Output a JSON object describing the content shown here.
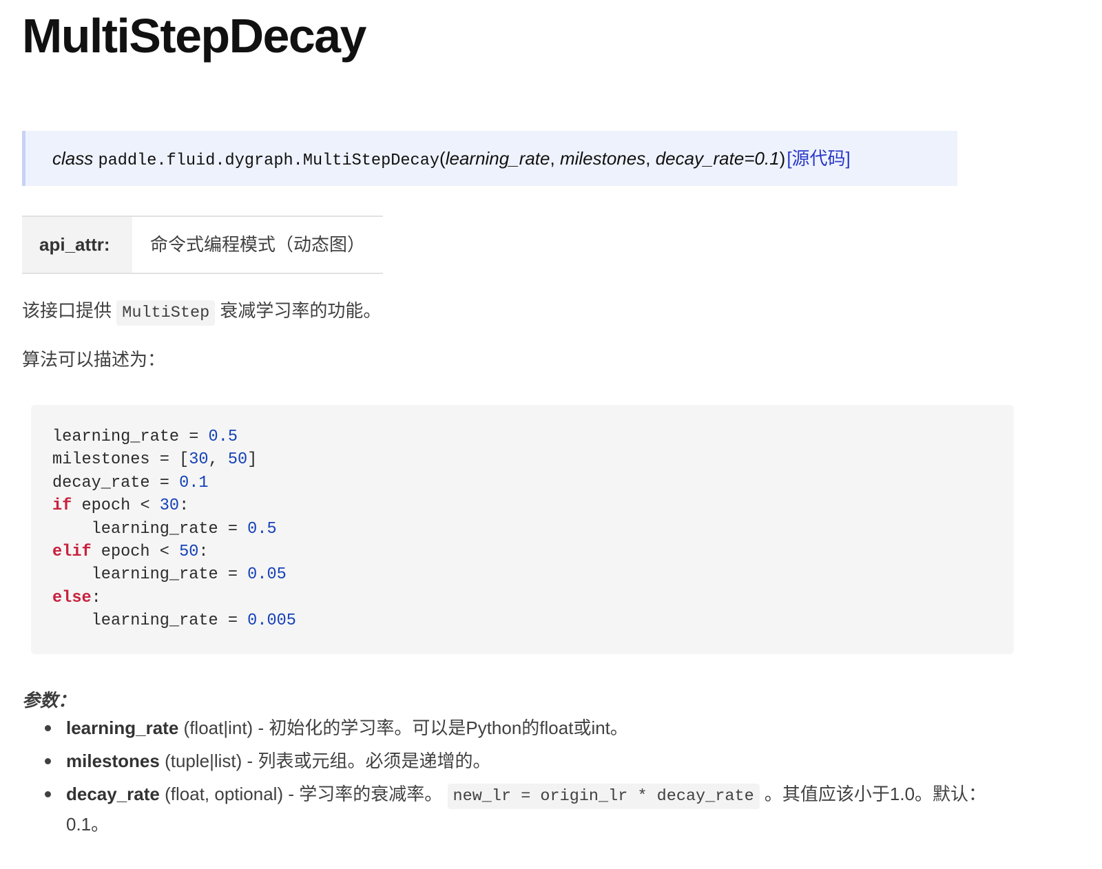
{
  "theme": {
    "text": "#404040",
    "heading": "#111111",
    "link": "#2a38c8",
    "keyword": "#c8213e",
    "number": "#1541b8",
    "code_bg": "#f5f5f5",
    "signature_bg": "#eef2fd",
    "signature_border": "#c7d2f4"
  },
  "title": "MultiStepDecay",
  "signature": {
    "prefix": "class",
    "name": "paddle.fluid.dygraph.MultiStepDecay",
    "open": "(",
    "params": [
      "learning_rate",
      "milestones",
      "decay_rate=0.1"
    ],
    "separator": ", ",
    "close": ")",
    "source_link": "[源代码]"
  },
  "api_attr": {
    "label": "api_attr:",
    "value": "命令式编程模式（动态图）"
  },
  "intro": {
    "before": "该接口提供",
    "code": "MultiStep",
    "after": "衰减学习率的功能。"
  },
  "algorithm_label": "算法可以描述为：",
  "code_block": {
    "lines": [
      [
        {
          "plain": "learning_rate = "
        },
        {
          "num": "0.5"
        }
      ],
      [
        {
          "plain": "milestones = ["
        },
        {
          "num": "30"
        },
        {
          "plain": ", "
        },
        {
          "num": "50"
        },
        {
          "plain": "]"
        }
      ],
      [
        {
          "plain": "decay_rate = "
        },
        {
          "num": "0.1"
        }
      ],
      [
        {
          "kw": "if"
        },
        {
          "plain": " epoch < "
        },
        {
          "num": "30"
        },
        {
          "plain": ":"
        }
      ],
      [
        {
          "plain": "    learning_rate = "
        },
        {
          "num": "0.5"
        }
      ],
      [
        {
          "kw": "elif"
        },
        {
          "plain": " epoch < "
        },
        {
          "num": "50"
        },
        {
          "plain": ":"
        }
      ],
      [
        {
          "plain": "    learning_rate = "
        },
        {
          "num": "0.05"
        }
      ],
      [
        {
          "kw": "else"
        },
        {
          "plain": ":"
        }
      ],
      [
        {
          "plain": "    learning_rate = "
        },
        {
          "num": "0.005"
        }
      ]
    ]
  },
  "params": {
    "heading": "参数：",
    "dash": "-",
    "items": [
      {
        "name": "learning_rate",
        "type": "(float|int)",
        "desc": "初始化的学习率。可以是Python的float或int。"
      },
      {
        "name": "milestones",
        "type": "(tuple|list)",
        "desc": "列表或元组。必须是递增的。"
      },
      {
        "name": "decay_rate",
        "type": "(float, optional)",
        "desc": "学习率的衰减率。",
        "code": "new_lr = origin_lr * decay_rate",
        "desc_after": "。其值应该小于1.0。默认：0.1。"
      }
    ]
  }
}
